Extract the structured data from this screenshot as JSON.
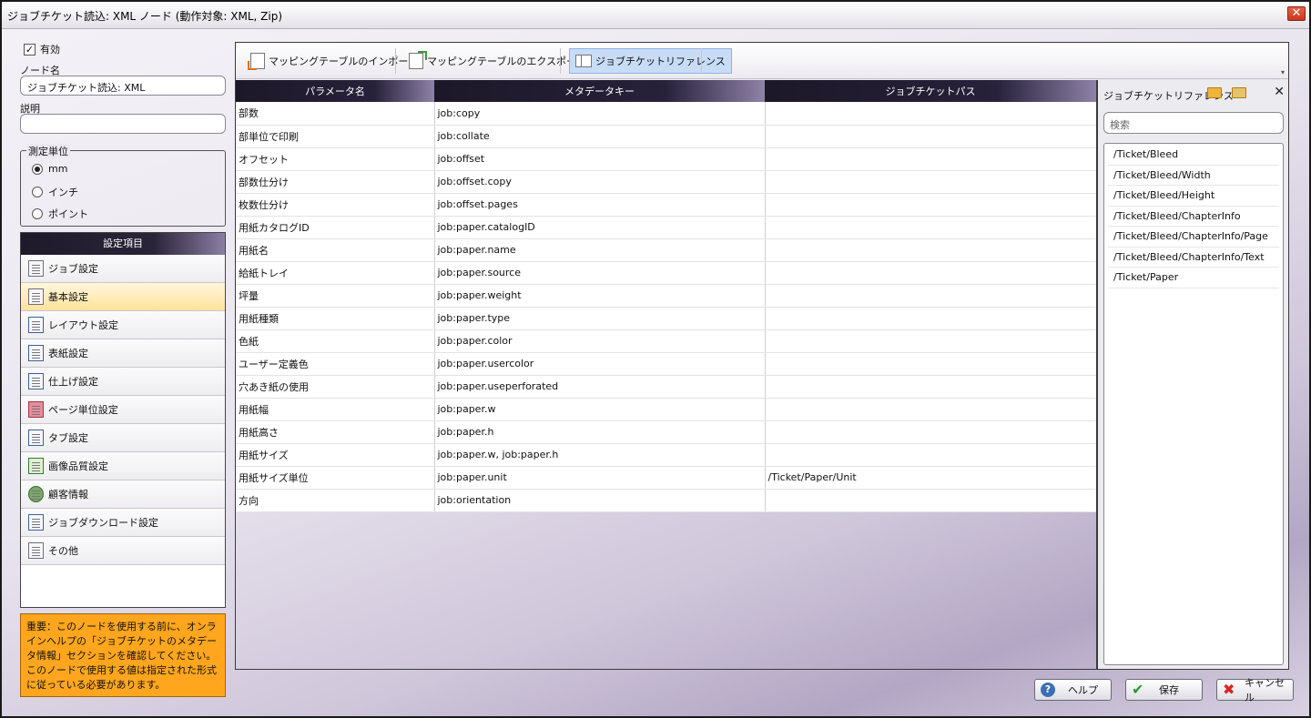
{
  "window": {
    "title": "ジョブチケット読込: XML ノード (動作対象: XML, Zip)",
    "close": "✕"
  },
  "left": {
    "enabled_label": "有効",
    "enabled_mark": "✓",
    "node_name_label": "ノード名",
    "node_name_value": "ジョブチケット読込: XML",
    "description_label": "説明",
    "description_value": "",
    "unit_legend": "測定単位",
    "units": [
      {
        "label": "mm",
        "selected": true
      },
      {
        "label": "インチ",
        "selected": false
      },
      {
        "label": "ポイント",
        "selected": false
      }
    ],
    "settings_header": "設定項目",
    "settings": [
      {
        "label": "ジョブ設定",
        "selected": false
      },
      {
        "label": "基本設定",
        "selected": true
      },
      {
        "label": "レイアウト設定",
        "selected": false
      },
      {
        "label": "表紙設定",
        "selected": false
      },
      {
        "label": "仕上げ設定",
        "selected": false
      },
      {
        "label": "ページ単位設定",
        "selected": false
      },
      {
        "label": "タブ設定",
        "selected": false
      },
      {
        "label": "画像品質設定",
        "selected": false
      },
      {
        "label": "顧客情報",
        "selected": false
      },
      {
        "label": "ジョブダウンロード設定",
        "selected": false
      },
      {
        "label": "その他",
        "selected": false
      }
    ],
    "notice": "重要：このノードを使用する前に、オンラインヘルプの「ジョブチケットのメタデータ情報」セクションを確認してください。このノードで使用する値は指定された形式に従っている必要があります。"
  },
  "toolbar": {
    "import_label": "マッピングテーブルのインポート",
    "export_label": "マッピングテーブルのエクスポート",
    "reference_label": "ジョブチケットリファレンス",
    "menu_glyph": "▾"
  },
  "table": {
    "headers": [
      "パラメータ名",
      "メタデータキー",
      "ジョブチケットパス"
    ],
    "rows": [
      [
        "部数",
        "job:copy",
        ""
      ],
      [
        "部単位で印刷",
        "job:collate",
        ""
      ],
      [
        "オフセット",
        "job:offset",
        ""
      ],
      [
        "部数仕分け",
        "job:offset.copy",
        ""
      ],
      [
        "枚数仕分け",
        "job:offset.pages",
        ""
      ],
      [
        "用紙カタログID",
        "job:paper.catalogID",
        ""
      ],
      [
        "用紙名",
        "job:paper.name",
        ""
      ],
      [
        "給紙トレイ",
        "job:paper.source",
        ""
      ],
      [
        "坪量",
        "job:paper.weight",
        ""
      ],
      [
        "用紙種類",
        "job:paper.type",
        ""
      ],
      [
        "色紙",
        "job:paper.color",
        ""
      ],
      [
        "ユーザー定義色",
        "job:paper.usercolor",
        ""
      ],
      [
        "穴あき紙の使用",
        "job:paper.useperforated",
        ""
      ],
      [
        "用紙幅",
        "job:paper.w",
        ""
      ],
      [
        "用紙高さ",
        "job:paper.h",
        ""
      ],
      [
        "用紙サイズ",
        "job:paper.w, job:paper.h",
        ""
      ],
      [
        "用紙サイズ単位",
        "job:paper.unit",
        "/Ticket/Paper/Unit"
      ],
      [
        "方向",
        "job:orientation",
        ""
      ]
    ]
  },
  "reference": {
    "title": "ジョブチケットリファレンス",
    "close": "✕",
    "search_placeholder": "検索",
    "items": [
      "/Ticket/Bleed",
      "/Ticket/Bleed/Width",
      "/Ticket/Bleed/Height",
      "/Ticket/Bleed/ChapterInfo",
      "/Ticket/Bleed/ChapterInfo/Page",
      "/Ticket/Bleed/ChapterInfo/Text",
      "/Ticket/Paper"
    ]
  },
  "buttons": {
    "help": "ヘルプ",
    "save": "保存",
    "cancel": "キャンセル",
    "help_glyph": "?",
    "save_glyph": "✔",
    "cancel_glyph": "✖"
  }
}
